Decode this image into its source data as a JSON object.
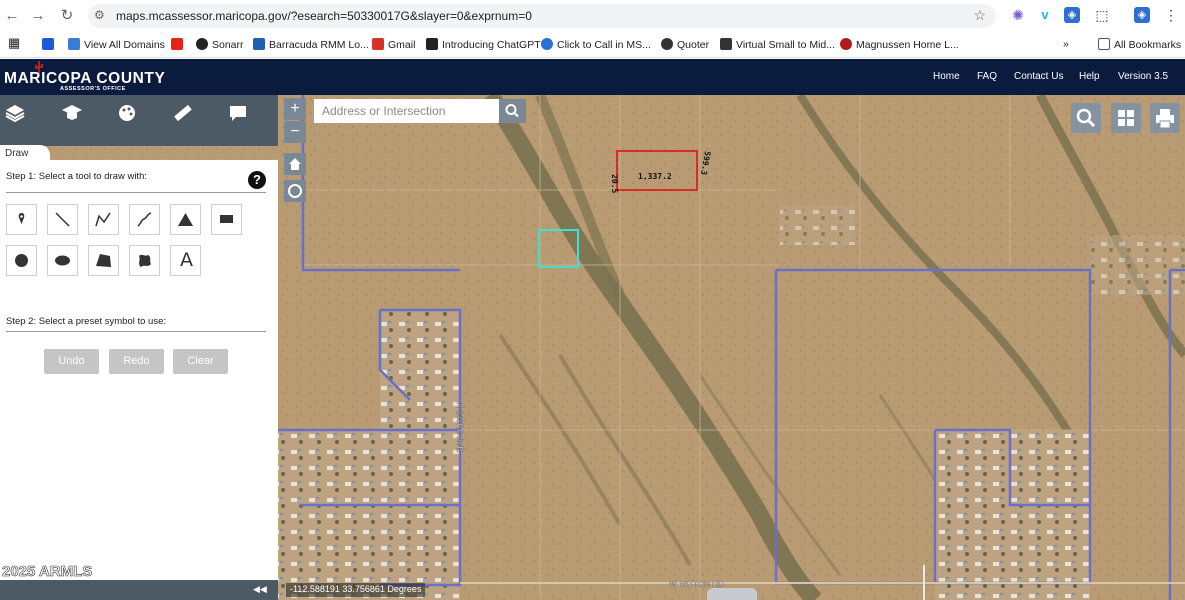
{
  "browser": {
    "url": "maps.mcassessor.maricopa.gov/?esearch=50330017G&slayer=0&exprnum=0",
    "bookmarks": [
      {
        "label": "",
        "color": "#1a5ad8"
      },
      {
        "label": "View All Domains",
        "color": "#3a7bd5"
      },
      {
        "label": "",
        "color": "#e62117"
      },
      {
        "label": "Sonarr",
        "color": "#222222"
      },
      {
        "label": "Barracuda RMM Lo...",
        "color": "#1f5fb3"
      },
      {
        "label": "Gmail",
        "color": "#d93025"
      },
      {
        "label": "Introducing ChatGPT",
        "color": "#222222"
      },
      {
        "label": "Click to Call in MS...",
        "color": "#2b6fd6"
      },
      {
        "label": "Quoter",
        "color": "#333333"
      },
      {
        "label": "Virtual Small to Mid...",
        "color": "#333333"
      },
      {
        "label": "Magnussen Home L...",
        "color": "#b31b1b"
      }
    ],
    "more_label": "»",
    "all_bookmarks_label": "All Bookmarks"
  },
  "header": {
    "logo_text": "MARICOPA COUNTY",
    "logo_sub": "ASSESSOR'S OFFICE",
    "nav": [
      "Home",
      "FAQ",
      "Contact Us",
      "Help",
      "Version 3.5"
    ]
  },
  "panel": {
    "tab_label": "Draw",
    "step1": "Step 1: Select a tool to draw with:",
    "step2": "Step 2: Select a preset symbol to use:",
    "help_glyph": "?",
    "text_tool_glyph": "A",
    "buttons": {
      "undo": "Undo",
      "redo": "Redo",
      "clear": "Clear"
    }
  },
  "map": {
    "search_placeholder": "Address or Intersection",
    "zoom_in": "+",
    "zoom_out": "−",
    "coordinates": "-112.588191 33.756861 Degrees",
    "street_vertical": "N 243RD AVE",
    "street_horizontal": "W PATTON RD",
    "parcel_label_1": "1,337.2",
    "parcel_label_2": "20.5",
    "parcel_label_3": "599.3",
    "copyright": "2025 ARMLS"
  },
  "colors": {
    "header_bg": "#0a1b3d",
    "toolbar_bg": "#4c5a66",
    "selected_parcel": "#e02020",
    "highlight_parcel": "#40e0d0",
    "boundary": "#6a6fc8"
  }
}
